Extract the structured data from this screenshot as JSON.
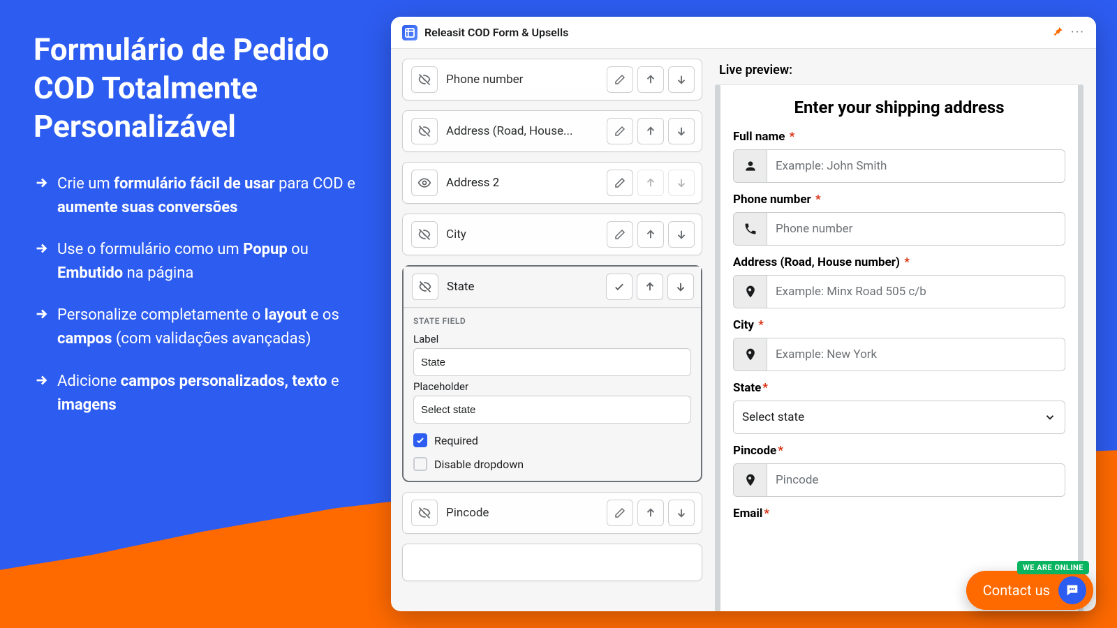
{
  "marketing": {
    "headline": "Formulário de Pedido COD Totalmente Personalizável",
    "bullets": [
      {
        "parts": [
          "Crie um ",
          "formulário fácil de usar",
          " para COD e ",
          "aumente suas conversões"
        ]
      },
      {
        "parts": [
          "Use o formulário como um ",
          "Popup",
          " ou ",
          "Embutido",
          " na página"
        ]
      },
      {
        "parts": [
          "Personalize completamente o ",
          "layout",
          " e os ",
          "campos",
          " (com validações avançadas)"
        ]
      },
      {
        "parts": [
          "Adicione ",
          "campos personalizados, texto",
          " e ",
          "imagens"
        ]
      }
    ]
  },
  "app": {
    "title": "Releasit COD Form & Upsells",
    "pin_icon": "📌",
    "menu_icon": "···"
  },
  "editor": {
    "rows": [
      {
        "id": "phone",
        "label": "Phone number",
        "vis": "hidden",
        "upDisabled": false,
        "downDisabled": false
      },
      {
        "id": "address1",
        "label": "Address (Road, House...",
        "vis": "hidden",
        "upDisabled": false,
        "downDisabled": false
      },
      {
        "id": "address2",
        "label": "Address 2",
        "vis": "visible",
        "upDisabled": true,
        "downDisabled": true
      },
      {
        "id": "city",
        "label": "City",
        "vis": "hidden",
        "upDisabled": false,
        "downDisabled": false
      }
    ],
    "expanded": {
      "id": "state",
      "label": "State",
      "section": "STATE FIELD",
      "label_lbl": "Label",
      "label_val": "State",
      "placeholder_lbl": "Placeholder",
      "placeholder_val": "Select state",
      "required_lbl": "Required",
      "required_on": true,
      "disable_lbl": "Disable dropdown",
      "disable_on": false
    },
    "tail": {
      "id": "pincode",
      "label": "Pincode",
      "vis": "hidden"
    }
  },
  "preview": {
    "title": "Live preview:",
    "heading": "Enter your shipping address",
    "fields": [
      {
        "id": "fullname",
        "label": "Full name",
        "icon": "person",
        "placeholder": "Example: John Smith"
      },
      {
        "id": "phone",
        "label": "Phone number",
        "icon": "phone",
        "placeholder": "Phone number"
      },
      {
        "id": "address",
        "label": "Address (Road, House number)",
        "icon": "pin",
        "placeholder": "Example: Minx Road 505 c/b"
      },
      {
        "id": "city",
        "label": "City",
        "icon": "pin",
        "placeholder": "Example: New York"
      }
    ],
    "state": {
      "label": "State",
      "placeholder": "Select state"
    },
    "pincode": {
      "label": "Pincode",
      "icon": "pin",
      "placeholder": "Pincode"
    },
    "email": {
      "label": "Email"
    }
  },
  "contact": {
    "label": "Contact us",
    "badge": "WE ARE ONLINE"
  }
}
